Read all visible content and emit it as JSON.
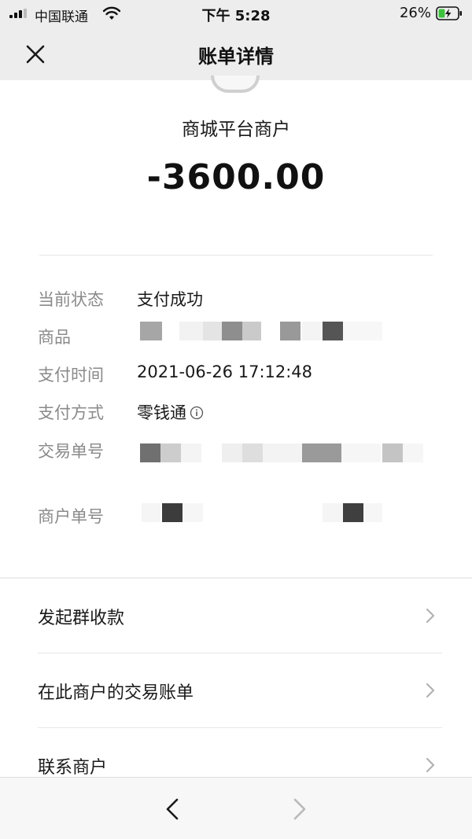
{
  "status_bar": {
    "carrier": "中国联通",
    "time": "下午 5:28",
    "battery": "26%"
  },
  "nav": {
    "title": "账单详情",
    "close_icon": "close-icon"
  },
  "summary": {
    "merchant": "商城平台商户",
    "amount": "-3600.00"
  },
  "details": [
    {
      "label": "当前状态",
      "value": "支付成功"
    },
    {
      "label": "商品",
      "value": ""
    },
    {
      "label": "支付时间",
      "value": "2021-06-26 17:12:48"
    },
    {
      "label": "支付方式",
      "value": "零钱通"
    },
    {
      "label": "交易单号",
      "value": ""
    },
    {
      "label": "商户单号",
      "value": ""
    }
  ],
  "actions": [
    {
      "label": "发起群收款"
    },
    {
      "label": "在此商户的交易账单"
    },
    {
      "label": "联系商户"
    }
  ],
  "colors": {
    "page_bg": "#ededed",
    "card_bg": "#ffffff",
    "label_gray": "#8a8a8a",
    "text_dark": "#191919"
  }
}
